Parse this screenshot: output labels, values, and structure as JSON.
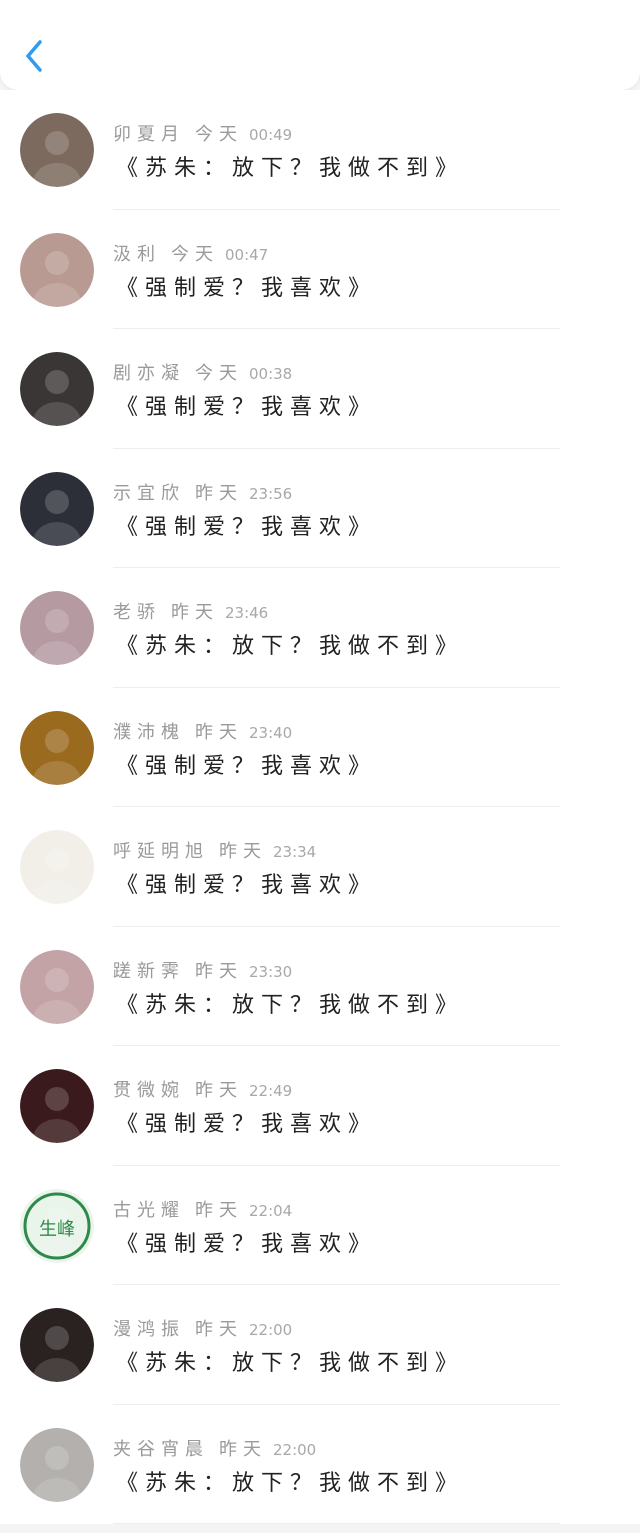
{
  "header": {
    "back_icon": "chevron-left-icon",
    "accent": "#2e9bf0"
  },
  "messages": [
    {
      "name": "卯夏月",
      "day": "今天",
      "time": "00:49",
      "text": "《苏朱：放下？我做不到》",
      "avatar_color": "#7c6a5f"
    },
    {
      "name": "汲利",
      "day": "今天",
      "time": "00:47",
      "text": "《强制爱？我喜欢》",
      "avatar_color": "#b89a92"
    },
    {
      "name": "剧亦凝",
      "day": "今天",
      "time": "00:38",
      "text": "《强制爱？我喜欢》",
      "avatar_color": "#3b3636"
    },
    {
      "name": "示宜欣",
      "day": "昨天",
      "time": "23:56",
      "text": "《强制爱？我喜欢》",
      "avatar_color": "#2c2f38"
    },
    {
      "name": "老骄",
      "day": "昨天",
      "time": "23:46",
      "text": "《苏朱：放下？我做不到》",
      "avatar_color": "#b59aa2"
    },
    {
      "name": "濮沛槐",
      "day": "昨天",
      "time": "23:40",
      "text": "《强制爱？我喜欢》",
      "avatar_color": "#9a6a1f"
    },
    {
      "name": "呼延明旭",
      "day": "昨天",
      "time": "23:34",
      "text": "《强制爱？我喜欢》",
      "avatar_color": "#f2efe8"
    },
    {
      "name": "蹉新霁",
      "day": "昨天",
      "time": "23:30",
      "text": "《苏朱：放下？我做不到》",
      "avatar_color": "#c3a3a5"
    },
    {
      "name": "贯微婉",
      "day": "昨天",
      "time": "22:49",
      "text": "《强制爱？我喜欢》",
      "avatar_color": "#3a1a1c"
    },
    {
      "name": "古光耀",
      "day": "昨天",
      "time": "22:04",
      "text": "《强制爱？我喜欢》",
      "avatar_color": "#e9f4ea",
      "avatar_text": "生峰"
    },
    {
      "name": "漫鸿振",
      "day": "昨天",
      "time": "22:00",
      "text": "《苏朱：放下？我做不到》",
      "avatar_color": "#2a2221"
    },
    {
      "name": "夹谷宵晨",
      "day": "昨天",
      "time": "22:00",
      "text": "《苏朱：放下？我做不到》",
      "avatar_color": "#b3b0ad"
    }
  ]
}
